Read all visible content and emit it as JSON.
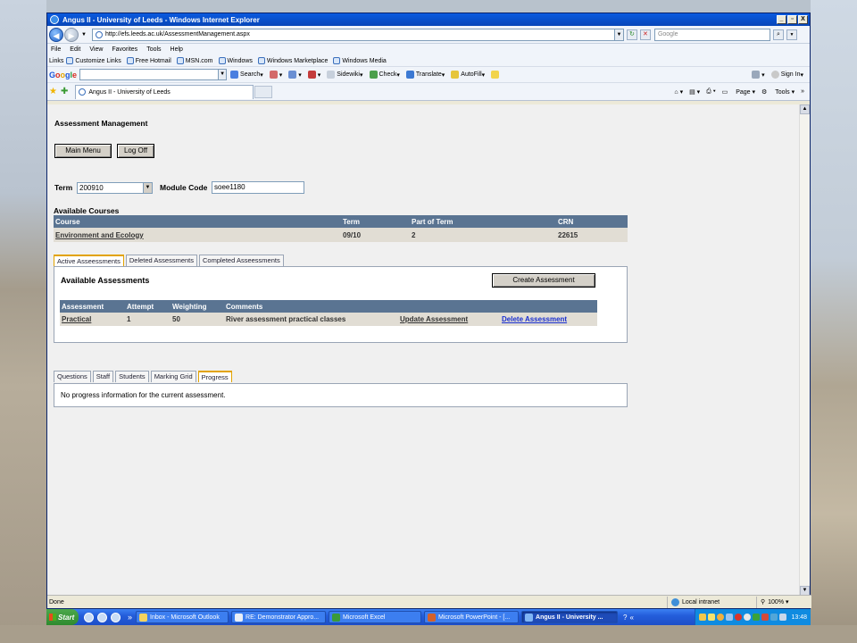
{
  "window": {
    "title": "Angus II - University of Leeds - Windows Internet Explorer",
    "controls": [
      "_",
      "▫",
      "X"
    ]
  },
  "address_bar": {
    "url": "http://efs.leeds.ac.uk/AssessmentManagement.aspx",
    "search_placeholder": "Google"
  },
  "menu": [
    "File",
    "Edit",
    "View",
    "Favorites",
    "Tools",
    "Help"
  ],
  "links_bar": {
    "label": "Links",
    "items": [
      "Customize Links",
      "Free Hotmail",
      "MSN.com",
      "Windows",
      "Windows Marketplace",
      "Windows Media"
    ]
  },
  "google_bar": {
    "logo": [
      "G",
      "o",
      "o",
      "g",
      "l",
      "e"
    ],
    "items": [
      "Search",
      "Sidewiki",
      "Check",
      "Translate",
      "AutoFill"
    ],
    "sign_in": "Sign In"
  },
  "tab_bar": {
    "tab_title": "Angus II - University of Leeds",
    "commands": [
      "Page",
      "Tools"
    ]
  },
  "page": {
    "heading": "Assessment Management",
    "main_menu_label": "Main Menu",
    "log_off_label": "Log Off",
    "term_label": "Term",
    "term_value": "200910",
    "module_code_label": "Module Code",
    "module_code_value": "soee1180",
    "available_courses_label": "Available Courses",
    "courses": {
      "headers": [
        "Course",
        "Term",
        "Part of Term",
        "CRN"
      ],
      "rows": [
        [
          "Environment and Ecology",
          "09/10",
          "2",
          "22615"
        ]
      ]
    },
    "assessment_tabs": [
      "Active Asseessments",
      "Deleted Assessments",
      "Completed Asseessments"
    ],
    "available_assessments_title": "Available Assessments",
    "create_assessment_label": "Create Assessment",
    "assessments": {
      "headers": [
        "Assessment",
        "Attempt",
        "Weighting",
        "Comments",
        "",
        ""
      ],
      "rows": [
        [
          "Practical",
          "1",
          "50",
          "River assessment practical classes",
          "Update Assessment",
          "Delete Assessment"
        ]
      ]
    },
    "detail_tabs": [
      "Questions",
      "Staff",
      "Students",
      "Marking Grid",
      "Progress"
    ],
    "progress_message": "No progress information for the current assessment."
  },
  "status_bar": {
    "status": "Done",
    "zone": "Local intranet",
    "zoom": "100%"
  },
  "taskbar": {
    "start": "Start",
    "tasks": [
      "Inbox - Microsoft Outlook",
      "RE: Demonstrator Appro...",
      "Microsoft Excel",
      "Microsoft PowerPoint - [...",
      "Angus II - University ..."
    ],
    "clock": "13:48"
  },
  "colors": {
    "table_header": "#5a7492",
    "table_row": "#e1ddd4",
    "active_tab_accent": "#e2a300",
    "link_blue": "#1a2fd0"
  }
}
